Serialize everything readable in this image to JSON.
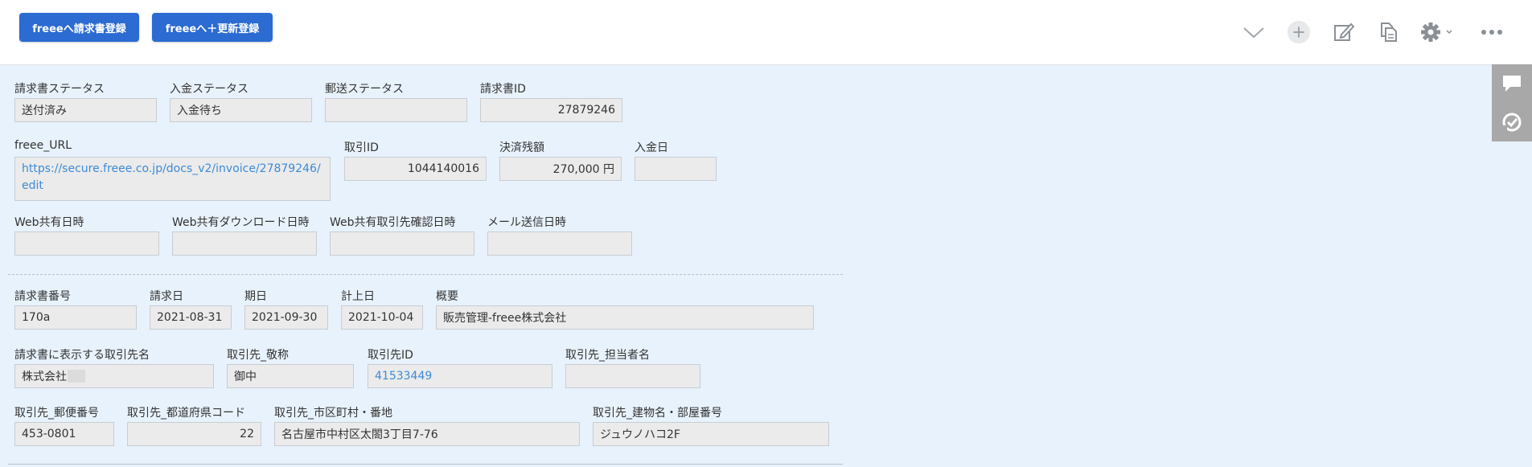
{
  "header": {
    "btn_invoice": "freeeへ請求書登録",
    "btn_update": "freeeへ＋更新登録",
    "icons": [
      "chevron-down-icon",
      "plus-icon",
      "edit-icon",
      "copy-icon",
      "gear-icon",
      "more-icon"
    ]
  },
  "status": {
    "invoice_status": {
      "label": "請求書ステータス",
      "value": "送付済み"
    },
    "payment_status": {
      "label": "入金ステータス",
      "value": "入金待ち"
    },
    "mail_status": {
      "label": "郵送ステータス",
      "value": ""
    },
    "invoice_id": {
      "label": "請求書ID",
      "value": "27879246"
    }
  },
  "freee": {
    "url": {
      "label": "freee_URL",
      "value": "https://secure.freee.co.jp/docs_v2/invoice/27879246/edit"
    },
    "deal_id": {
      "label": "取引ID",
      "value": "1044140016"
    },
    "balance": {
      "label": "決済残額",
      "value": "270,000 円"
    },
    "paid_date": {
      "label": "入金日",
      "value": ""
    }
  },
  "web": {
    "share_date": {
      "label": "Web共有日時",
      "value": ""
    },
    "download_date": {
      "label": "Web共有ダウンロード日時",
      "value": ""
    },
    "confirm_date": {
      "label": "Web共有取引先確認日時",
      "value": ""
    },
    "mail_date": {
      "label": "メール送信日時",
      "value": ""
    }
  },
  "invoice": {
    "number": {
      "label": "請求書番号",
      "value": "170a"
    },
    "issue_date": {
      "label": "請求日",
      "value": "2021-08-31"
    },
    "due_date": {
      "label": "期日",
      "value": "2021-09-30"
    },
    "booking_date": {
      "label": "計上日",
      "value": "2021-10-04"
    },
    "summary": {
      "label": "概要",
      "value": "販売管理-freee株式会社"
    }
  },
  "partner": {
    "display_name": {
      "label": "請求書に表示する取引先名",
      "value": "株式会社"
    },
    "honorific": {
      "label": "取引先_敬称",
      "value": "御中"
    },
    "partner_id": {
      "label": "取引先ID",
      "value": "41533449"
    },
    "contact": {
      "label": "取引先_担当者名",
      "value": ""
    }
  },
  "address": {
    "zip": {
      "label": "取引先_郵便番号",
      "value": "453-0801"
    },
    "pref_code": {
      "label": "取引先_都道府県コード",
      "value": "22"
    },
    "city": {
      "label": "取引先_市区町村・番地",
      "value": "名古屋市中村区太閤3丁目7-76"
    },
    "building": {
      "label": "取引先_建物名・部屋番号",
      "value": "ジュウノハコ2F"
    }
  }
}
